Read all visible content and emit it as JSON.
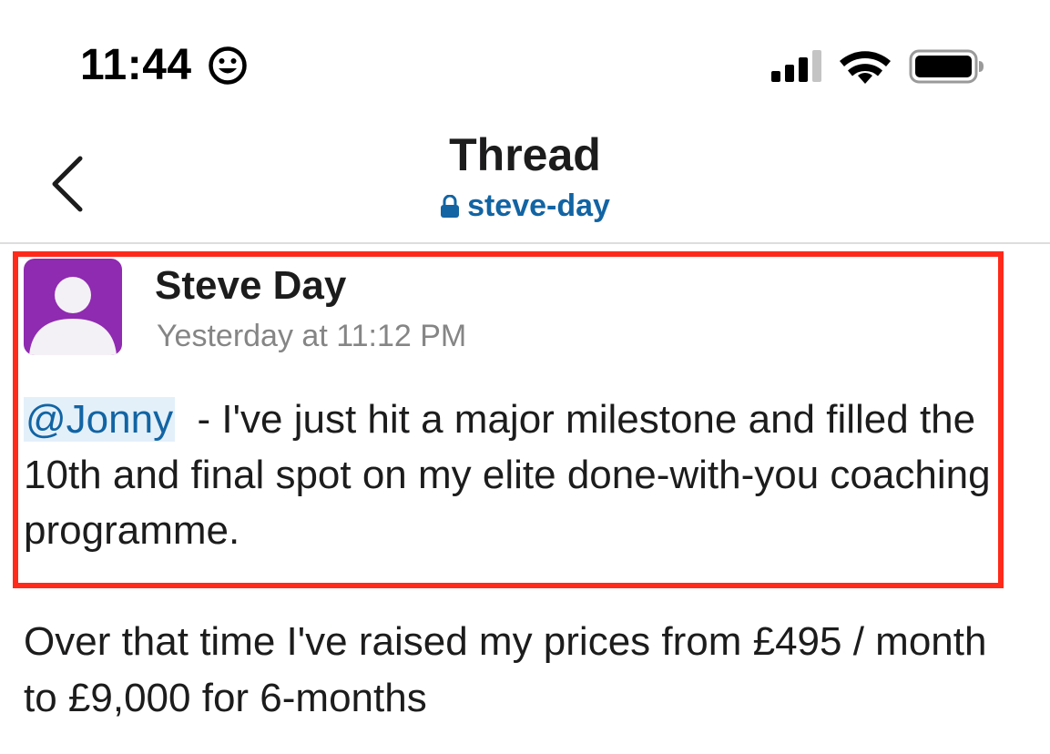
{
  "status_bar": {
    "time": "11:44",
    "time_emoji_icon": "smiley-face-icon",
    "signal_icon": "cellular-signal-icon",
    "wifi_icon": "wifi-icon",
    "battery_icon": "battery-icon"
  },
  "header": {
    "back_icon": "chevron-left-icon",
    "title": "Thread",
    "channel_lock_icon": "lock-icon",
    "channel_name": "steve-day"
  },
  "message": {
    "author": "Steve Day",
    "timestamp": "Yesterday at 11:12 PM",
    "avatar_icon": "default-user-avatar-icon",
    "mention": "@Jonny",
    "text_after_mention": "  - I've just hit a major milestone and filled the 10th and final spot on my elite done-with-you coaching programme.",
    "continued_text": "Over that time I've raised my prices from £495 / month to £9,000 for 6-months"
  },
  "colors": {
    "link": "#1264a3",
    "avatar": "#8f2bb0",
    "highlight_border": "#ff2a1a",
    "mention_bg": "#e3f0fa",
    "timestamp": "#858585"
  }
}
